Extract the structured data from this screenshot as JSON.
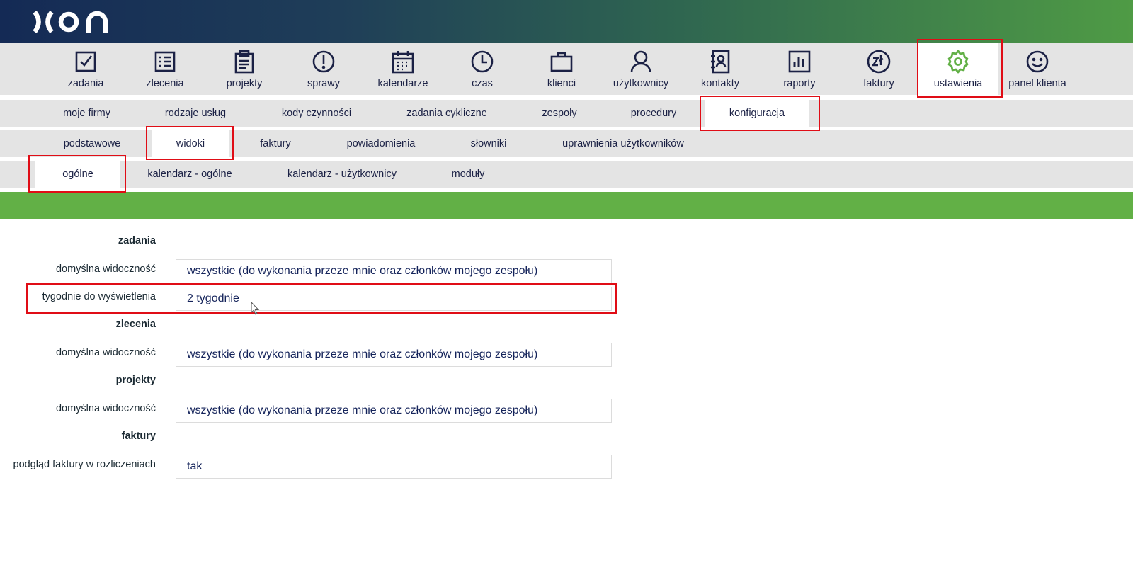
{
  "header": {
    "logo_text": "XON",
    "colors": {
      "gradient_start": "#142a55",
      "gradient_end": "#4f9b45",
      "accent_green": "#62b046",
      "highlight_red": "#e00d16"
    }
  },
  "main_menu": [
    {
      "label": "zadania",
      "icon": "checkbox-icon"
    },
    {
      "label": "zlecenia",
      "icon": "list-icon"
    },
    {
      "label": "projekty",
      "icon": "clipboard-icon"
    },
    {
      "label": "sprawy",
      "icon": "exclamation-icon"
    },
    {
      "label": "kalendarze",
      "icon": "calendar-icon"
    },
    {
      "label": "czas",
      "icon": "clock-icon"
    },
    {
      "label": "klienci",
      "icon": "briefcase-icon"
    },
    {
      "label": "użytkownicy",
      "icon": "user-icon"
    },
    {
      "label": "kontakty",
      "icon": "address-book-icon"
    },
    {
      "label": "raporty",
      "icon": "bar-chart-icon"
    },
    {
      "label": "faktury",
      "icon": "zloty-icon"
    },
    {
      "label": "ustawienia",
      "icon": "gear-icon",
      "active": true
    },
    {
      "label": "panel klienta",
      "icon": "smiley-icon"
    }
  ],
  "settings_tabs": [
    "moje firmy",
    "rodzaje usług",
    "kody czynności",
    "zadania cykliczne",
    "zespoły",
    "procedury",
    "konfiguracja"
  ],
  "config_tabs": [
    "podstawowe",
    "widoki",
    "faktury",
    "powiadomienia",
    "słowniki",
    "uprawnienia użytkowników"
  ],
  "view_tabs": [
    "ogólne",
    "kalendarz - ogólne",
    "kalendarz - użytkownicy",
    "moduły"
  ],
  "form": {
    "zadania": {
      "heading": "zadania",
      "visibility_label": "domyślna widoczność",
      "visibility_value": "wszystkie (do wykonania przeze mnie oraz członków mojego zespołu)",
      "weeks_label": "tygodnie do wyświetlenia",
      "weeks_value": "2 tygodnie"
    },
    "zlecenia": {
      "heading": "zlecenia",
      "visibility_label": "domyślna widoczność",
      "visibility_value": "wszystkie (do wykonania przeze mnie oraz członków mojego zespołu)"
    },
    "projekty": {
      "heading": "projekty",
      "visibility_label": "domyślna widoczność",
      "visibility_value": "wszystkie (do wykonania przeze mnie oraz członków mojego zespołu)"
    },
    "faktury": {
      "heading": "faktury",
      "preview_label": "podgląd faktury w rozliczeniach",
      "preview_value": "tak"
    }
  }
}
